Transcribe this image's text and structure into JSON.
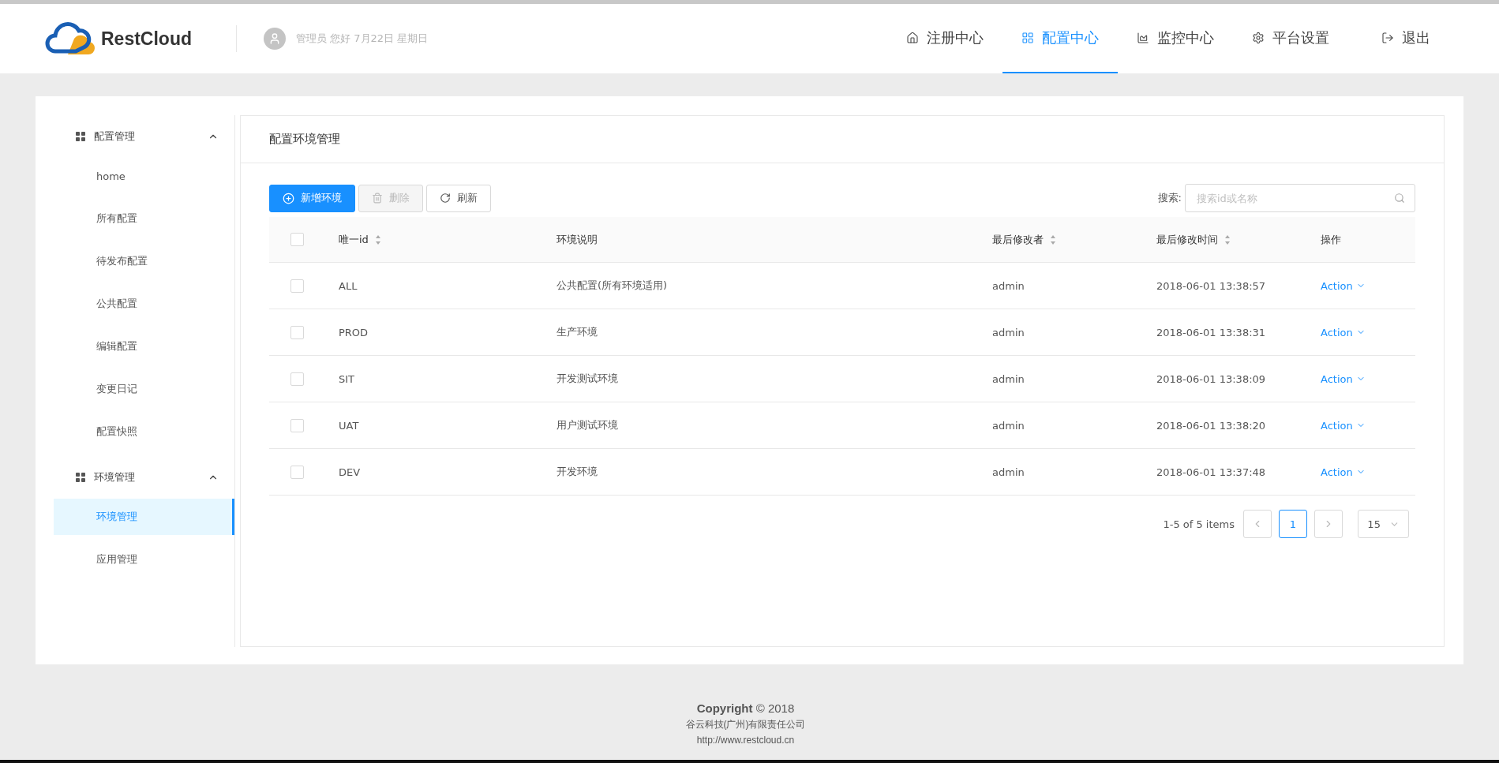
{
  "header": {
    "brand": "RestCloud",
    "greeting": "管理员 您好 7月22日 星期日",
    "nav": [
      {
        "label": "注册中心",
        "kind": "home",
        "selected": false
      },
      {
        "label": "配置中心",
        "kind": "grid",
        "selected": true
      },
      {
        "label": "监控中心",
        "kind": "chart",
        "selected": false
      },
      {
        "label": "平台设置",
        "kind": "gear",
        "selected": false
      },
      {
        "label": "退出",
        "kind": "logout",
        "selected": false
      }
    ]
  },
  "sidebar": {
    "groups": [
      {
        "label": "配置管理",
        "expanded": true,
        "children": [
          {
            "label": "home",
            "selected": false
          },
          {
            "label": "所有配置",
            "selected": false
          },
          {
            "label": "待发布配置",
            "selected": false
          },
          {
            "label": "公共配置",
            "selected": false
          },
          {
            "label": "编辑配置",
            "selected": false
          },
          {
            "label": "变更日记",
            "selected": false
          },
          {
            "label": "配置快照",
            "selected": false
          }
        ]
      },
      {
        "label": "环境管理",
        "expanded": true,
        "children": [
          {
            "label": "环境管理",
            "selected": true
          },
          {
            "label": "应用管理",
            "selected": false
          }
        ]
      }
    ]
  },
  "panel": {
    "title": "配置环境管理",
    "toolbar": [
      {
        "label": "新增环境",
        "kind": "add",
        "disabled": false
      },
      {
        "label": "删除",
        "kind": "delete",
        "disabled": true
      },
      {
        "label": "刷新",
        "kind": "refresh",
        "disabled": false
      }
    ],
    "search": {
      "label": "搜索:",
      "placeholder": "搜索id或名称"
    },
    "table": {
      "all_checked": false,
      "columns": [
        {
          "label": "唯一id",
          "sortable": true
        },
        {
          "label": "环境说明",
          "sortable": false
        },
        {
          "label": "最后修改者",
          "sortable": true
        },
        {
          "label": "最后修改时间",
          "sortable": true
        },
        {
          "label": "操作",
          "sortable": false
        }
      ],
      "rows": [
        {
          "checked": false,
          "cells": [
            "ALL",
            "公共配置(所有环境适用)",
            "admin",
            "2018-06-01 13:38:57"
          ],
          "action": "Action"
        },
        {
          "checked": false,
          "cells": [
            "PROD",
            "生产环境",
            "admin",
            "2018-06-01 13:38:31"
          ],
          "action": "Action"
        },
        {
          "checked": false,
          "cells": [
            "SIT",
            "开发测试环境",
            "admin",
            "2018-06-01 13:38:09"
          ],
          "action": "Action"
        },
        {
          "checked": false,
          "cells": [
            "UAT",
            "用户测试环境",
            "admin",
            "2018-06-01 13:38:20"
          ],
          "action": "Action"
        },
        {
          "checked": false,
          "cells": [
            "DEV",
            "开发环境",
            "admin",
            "2018-06-01 13:37:48"
          ],
          "action": "Action"
        }
      ]
    },
    "pagination": {
      "summary": "1-5 of 5 items",
      "pages": [
        {
          "label": "1",
          "selected": true
        }
      ],
      "page_size": "15"
    }
  },
  "footer": {
    "copyright": "**Copyright** © 2018",
    "company": "谷云科技(广州)有限责任公司",
    "url": "http://www.restcloud.cn"
  }
}
